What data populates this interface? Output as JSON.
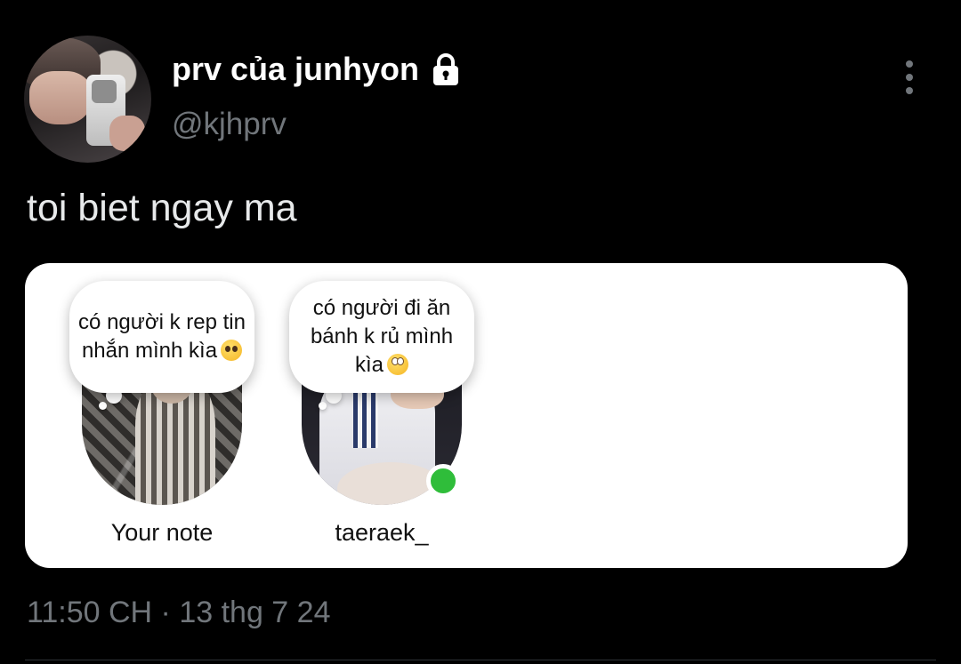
{
  "author": {
    "display_name": "prv của junhyon",
    "handle": "@kjhprv",
    "protected_icon": "lock-icon",
    "avatar": "profile-photo"
  },
  "menu": {
    "icon": "more-vertical-icon"
  },
  "tweet": {
    "text": "toi biet ngay ma",
    "timestamp": "11:50 CH · 13 thg 7 24"
  },
  "media": {
    "notes": [
      {
        "bubble_text": "có người k rep tin nhắn mình kìa",
        "emoji": "pleading-face-emoji",
        "label": "Your note",
        "online": false
      },
      {
        "bubble_text": "có người đi ăn bánh k rủ mình kìa",
        "emoji": "face-with-rolling-eyes-emoji",
        "label": "taeraek_",
        "online": true
      }
    ]
  },
  "colors": {
    "background": "#000000",
    "primary_text": "#e7e9ea",
    "secondary_text": "#71767b",
    "card": "#ffffff",
    "online": "#2fbd3a"
  }
}
